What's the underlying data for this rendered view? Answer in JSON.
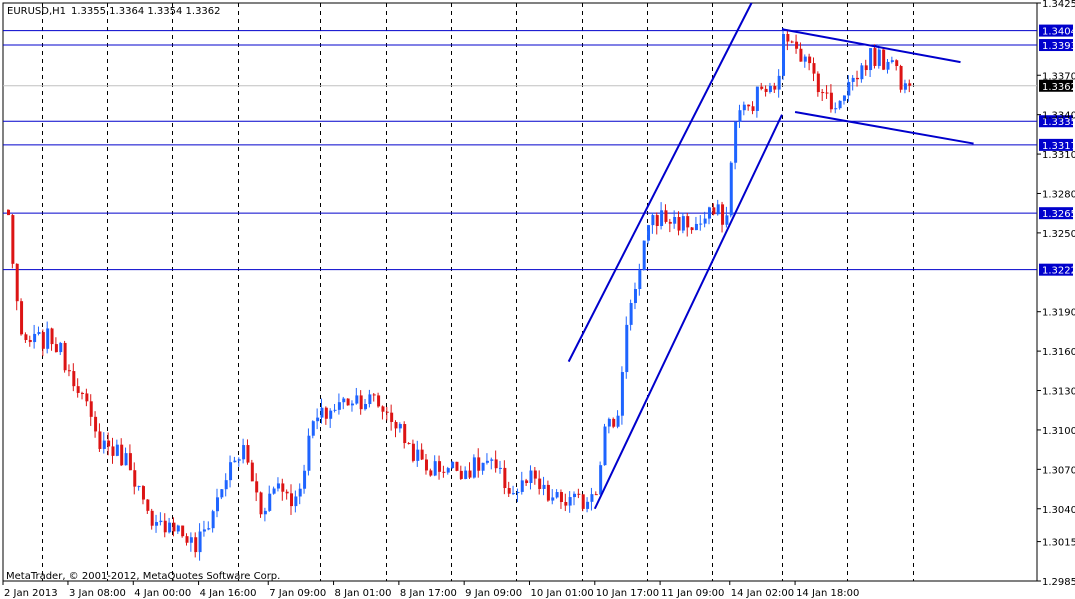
{
  "header": {
    "symbol_label": "EURUSD,H1",
    "ohlc_label": "1.3355 1.3364 1.3354 1.3362"
  },
  "footer": {
    "copyright": "MetaTrader, © 2001-2012, MetaQuotes Software Corp."
  },
  "colors": {
    "bull": "#1e64ff",
    "bear": "#dc1414",
    "level": "#0000cc",
    "channel": "#0000cc",
    "grid": "#000000",
    "current": "#c0c0c0"
  },
  "chart_data": {
    "type": "candlestick",
    "symbol": "EURUSD",
    "timeframe": "H1",
    "ylim": [
      1.2985,
      1.3425
    ],
    "y_ticks": [
      "1.3425",
      "1.3370",
      "1.3340",
      "1.3310",
      "1.3280",
      "1.3250",
      "1.3190",
      "1.3160",
      "1.3130",
      "1.3100",
      "1.3070",
      "1.3040",
      "1.3015",
      "1.2985"
    ],
    "x_ticks": [
      "2 Jan 2013",
      "3 Jan 08:00",
      "4 Jan 00:00",
      "4 Jan 16:00",
      "7 Jan 09:00",
      "8 Jan 01:00",
      "8 Jan 17:00",
      "9 Jan 09:00",
      "10 Jan 01:00",
      "10 Jan 17:00",
      "11 Jan 09:00",
      "14 Jan 02:00",
      "14 Jan 18:00"
    ],
    "grid": true,
    "horizontal_levels": [
      "1.3404",
      "1.3393",
      "1.3335",
      "1.3317",
      "1.3265",
      "1.3222"
    ],
    "current_price": "1.3362",
    "anchors": [
      {
        "bar": 0,
        "price": 1.3262
      },
      {
        "bar": 3,
        "price": 1.3165
      },
      {
        "bar": 10,
        "price": 1.317
      },
      {
        "bar": 16,
        "price": 1.3135
      },
      {
        "bar": 20,
        "price": 1.3095
      },
      {
        "bar": 28,
        "price": 1.3075
      },
      {
        "bar": 33,
        "price": 1.3022
      },
      {
        "bar": 37,
        "price": 1.3032
      },
      {
        "bar": 43,
        "price": 1.301
      },
      {
        "bar": 46,
        "price": 1.303
      },
      {
        "bar": 50,
        "price": 1.3065
      },
      {
        "bar": 54,
        "price": 1.3085
      },
      {
        "bar": 58,
        "price": 1.304
      },
      {
        "bar": 62,
        "price": 1.306
      },
      {
        "bar": 66,
        "price": 1.3045
      },
      {
        "bar": 70,
        "price": 1.3105
      },
      {
        "bar": 74,
        "price": 1.3115
      },
      {
        "bar": 79,
        "price": 1.3125
      },
      {
        "bar": 84,
        "price": 1.3122
      },
      {
        "bar": 88,
        "price": 1.311
      },
      {
        "bar": 92,
        "price": 1.3088
      },
      {
        "bar": 96,
        "price": 1.307
      },
      {
        "bar": 100,
        "price": 1.3072
      },
      {
        "bar": 106,
        "price": 1.307
      },
      {
        "bar": 110,
        "price": 1.3075
      },
      {
        "bar": 116,
        "price": 1.3052
      },
      {
        "bar": 120,
        "price": 1.3062
      },
      {
        "bar": 124,
        "price": 1.3048
      },
      {
        "bar": 128,
        "price": 1.3045
      },
      {
        "bar": 132,
        "price": 1.3045
      },
      {
        "bar": 135,
        "price": 1.3058
      },
      {
        "bar": 137,
        "price": 1.31
      },
      {
        "bar": 140,
        "price": 1.311
      },
      {
        "bar": 142,
        "price": 1.3185
      },
      {
        "bar": 145,
        "price": 1.3215
      },
      {
        "bar": 147,
        "price": 1.326
      },
      {
        "bar": 150,
        "price": 1.3262
      },
      {
        "bar": 154,
        "price": 1.3258
      },
      {
        "bar": 158,
        "price": 1.3255
      },
      {
        "bar": 162,
        "price": 1.3265
      },
      {
        "bar": 165,
        "price": 1.3262
      },
      {
        "bar": 167,
        "price": 1.334
      },
      {
        "bar": 170,
        "price": 1.3345
      },
      {
        "bar": 173,
        "price": 1.336
      },
      {
        "bar": 176,
        "price": 1.3355
      },
      {
        "bar": 178,
        "price": 1.3395
      },
      {
        "bar": 180,
        "price": 1.3402
      },
      {
        "bar": 183,
        "price": 1.338
      },
      {
        "bar": 186,
        "price": 1.3365
      },
      {
        "bar": 189,
        "price": 1.3345
      },
      {
        "bar": 192,
        "price": 1.336
      },
      {
        "bar": 195,
        "price": 1.337
      },
      {
        "bar": 198,
        "price": 1.3385
      },
      {
        "bar": 201,
        "price": 1.338
      },
      {
        "bar": 203,
        "price": 1.3388
      },
      {
        "bar": 205,
        "price": 1.336
      },
      {
        "bar": 207,
        "price": 1.3362
      }
    ],
    "trendlines": [
      {
        "from": {
          "bar": 129,
          "price": 1.3152
        },
        "to": {
          "bar": 171,
          "price": 1.3425
        }
      },
      {
        "from": {
          "bar": 135,
          "price": 1.304
        },
        "to": {
          "bar": 178,
          "price": 1.334
        }
      },
      {
        "from": {
          "bar": 178,
          "price": 1.3405
        },
        "to": {
          "bar": 219,
          "price": 1.338
        }
      },
      {
        "from": {
          "bar": 181,
          "price": 1.3342
        },
        "to": {
          "bar": 222,
          "price": 1.3318
        }
      }
    ]
  }
}
